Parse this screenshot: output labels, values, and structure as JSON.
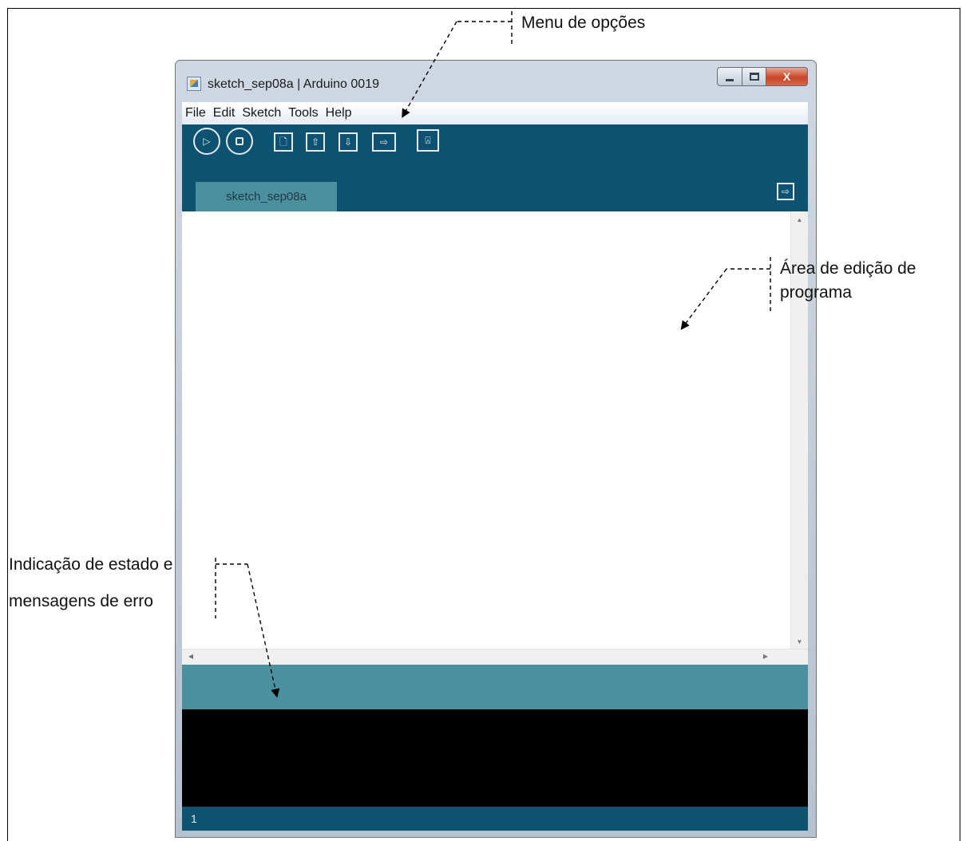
{
  "window": {
    "title": "sketch_sep08a | Arduino 0019",
    "app_icon": "arduino-app-icon",
    "controls": {
      "minimize_icon": "minimize-icon",
      "maximize_icon": "maximize-icon",
      "close_label": "X"
    }
  },
  "menubar": {
    "items": [
      "File",
      "Edit",
      "Sketch",
      "Tools",
      "Help"
    ]
  },
  "toolbar": {
    "buttons": [
      {
        "name": "verify-button",
        "icon": "play-icon",
        "glyph": "▷"
      },
      {
        "name": "stop-button",
        "icon": "stop-icon",
        "glyph": ""
      },
      {
        "name": "new-button",
        "icon": "new-file-icon",
        "glyph": "🗋"
      },
      {
        "name": "open-button",
        "icon": "open-arrow-up-icon",
        "glyph": "⇧"
      },
      {
        "name": "save-button",
        "icon": "save-arrow-down-icon",
        "glyph": "⇩"
      },
      {
        "name": "upload-button",
        "icon": "upload-arrow-right-icon",
        "glyph": "⇨"
      },
      {
        "name": "serial-monitor-button",
        "icon": "serial-monitor-icon",
        "glyph": "⍓"
      }
    ]
  },
  "tabs": {
    "items": [
      "sketch_sep08a"
    ],
    "menu_icon": "tab-menu-arrow-icon"
  },
  "editor": {
    "content": ""
  },
  "status": {
    "message": "",
    "console": "",
    "line_number": "1"
  },
  "annotations": {
    "menu": "Menu de opções",
    "editor_line1": "Área de edição de",
    "editor_line2": "programa",
    "status_line1": "Indicação de estado e",
    "status_line2": "mensagens de erro"
  },
  "colors": {
    "toolbar": "#0e5272",
    "tab_active": "#4a909f",
    "status_bar": "#4a909f",
    "console": "#000000"
  }
}
